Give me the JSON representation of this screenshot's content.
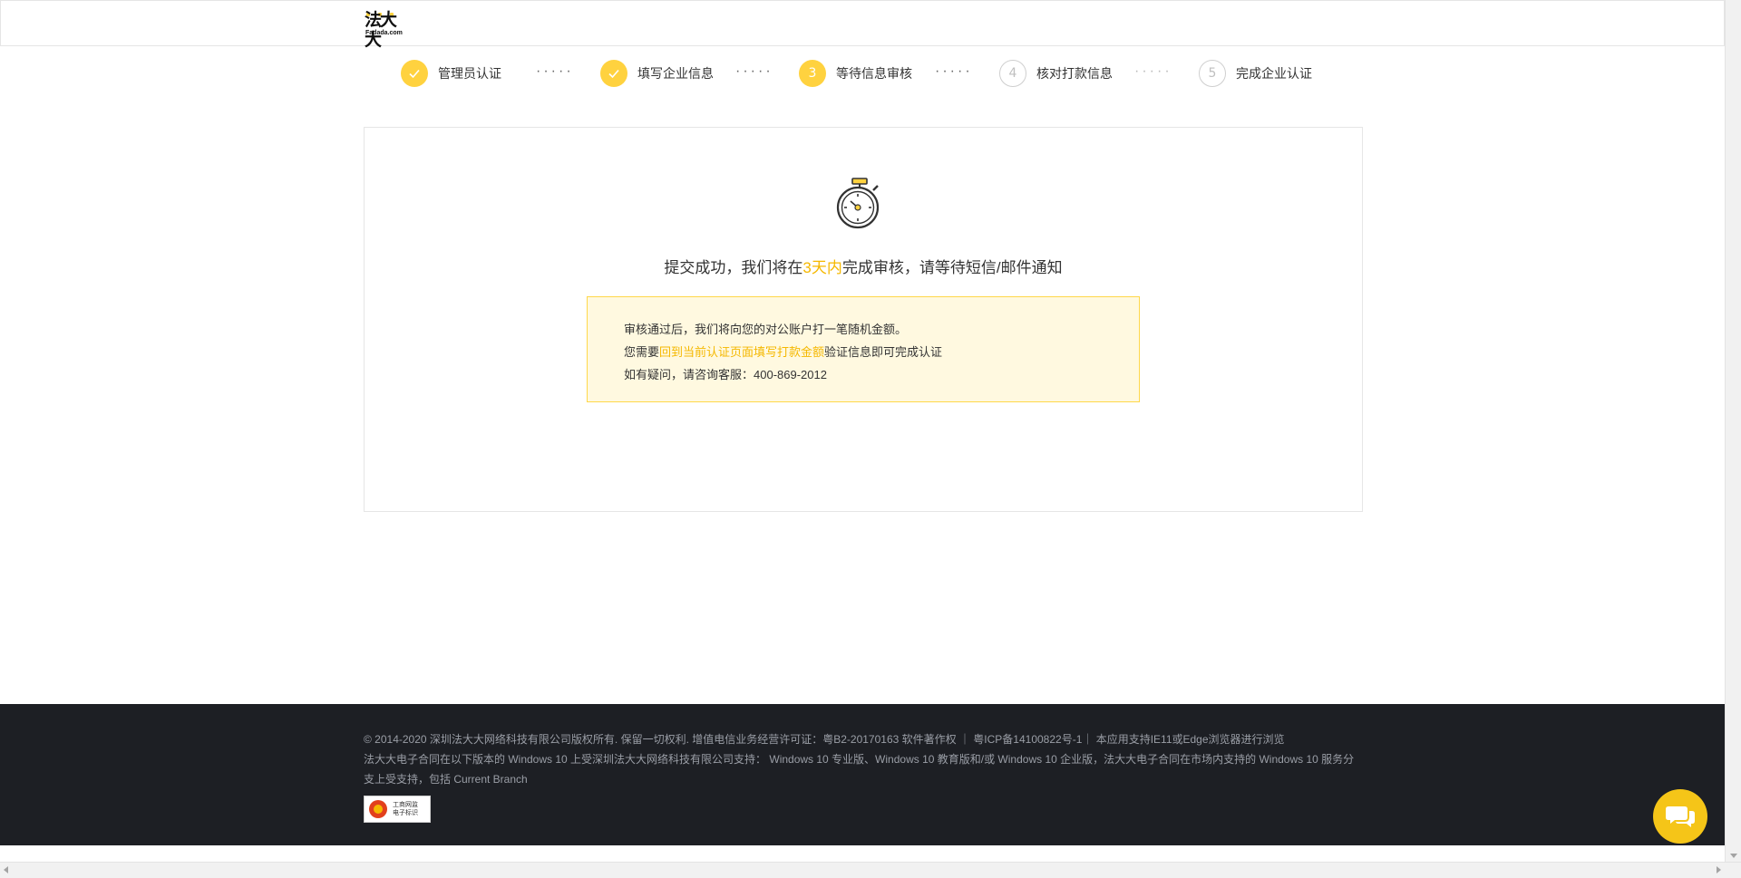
{
  "header": {
    "logo_cn": "法大大",
    "logo_en": "Fadada.com"
  },
  "steps": [
    {
      "index": "1",
      "label": "管理员认证",
      "status": "done",
      "icon": "check-icon"
    },
    {
      "index": "2",
      "label": "填写企业信息",
      "status": "done",
      "icon": "check-icon"
    },
    {
      "index": "3",
      "label": "等待信息审核",
      "status": "active"
    },
    {
      "index": "4",
      "label": "核对打款信息",
      "status": "todo"
    },
    {
      "index": "5",
      "label": "完成企业认证",
      "status": "todo"
    }
  ],
  "step_separator": "·····",
  "main": {
    "icon": "stopwatch-icon",
    "title_before": "提交成功，我们将在",
    "title_highlight": "3天内",
    "title_after": "完成审核，请等待短信/邮件通知",
    "notice": {
      "line1": "审核通过后，我们将向您的对公账户打一笔随机金额。",
      "line2_before": "您需要",
      "line2_highlight": "回到当前认证页面填写打款金额",
      "line2_after": "验证信息即可完成认证",
      "line3": "如有疑问，请咨询客服：400-869-2012"
    }
  },
  "footer": {
    "line1": "© 2014-2020 深圳法大大网络科技有限公司版权所有. 保留一切权利. 增值电信业务经营许可证：粤B2-20170163 软件著作权 ｜ 粤ICP备14100822号-1｜ 本应用支持IE11或Edge浏览器进行浏览",
    "line2": "法大大电子合同在以下版本的 Windows 10 上受深圳法大大网络科技有限公司支持： Windows 10 专业版、Windows 10 教育版和/或 Windows 10 企业版，法大大电子合同在市场内支持的 Windows 10 服务分支上受支持，包括 Current Branch",
    "badge_line1": "工商网监",
    "badge_line2": "电子标识"
  },
  "colors": {
    "accent": "#ffd23f",
    "highlight_text": "#f5b800",
    "notice_bg": "#fff9e0",
    "footer_bg": "#1d1f24"
  },
  "chat_icon": "chat-bubble-icon"
}
